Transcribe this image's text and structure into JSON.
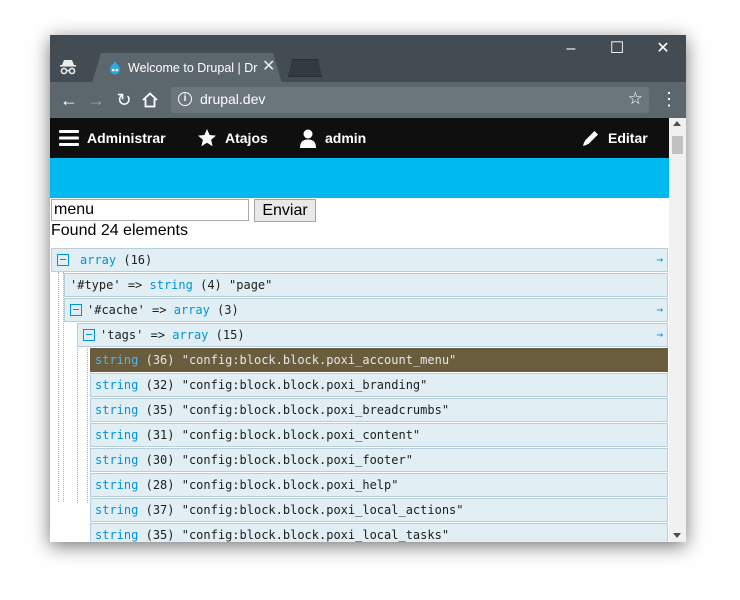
{
  "browser": {
    "tab_title": "Welcome to Drupal | Dru",
    "url": "drupal.dev",
    "window_controls": {
      "minimize": "–",
      "maximize": "☐",
      "close": "✕"
    },
    "tab_close": "✕"
  },
  "admin_toolbar": {
    "items": [
      {
        "label": "Administrar",
        "icon": "hamburger-icon"
      },
      {
        "label": "Atajos",
        "icon": "star-icon"
      },
      {
        "label": "admin",
        "icon": "user-icon"
      }
    ],
    "edit_label": "Editar",
    "edit_icon": "pencil-icon"
  },
  "search": {
    "value": "menu",
    "button_label": "Enviar",
    "result": "Found 24 elements"
  },
  "dump": {
    "root": {
      "type": "array",
      "meta": "(16)"
    },
    "type_entry": {
      "key": "'#type'",
      "op": "=>",
      "type": "string",
      "meta": "(4)",
      "value": "\"page\""
    },
    "cache_entry": {
      "key": "'#cache'",
      "op": "=>",
      "type": "array",
      "meta": "(3)"
    },
    "tags_entry": {
      "key": "'tags'",
      "op": "=>",
      "type": "array",
      "meta": "(15)"
    },
    "items": [
      {
        "type": "string",
        "meta": "(36)",
        "value": "\"config:block.block.poxi_account_menu\""
      },
      {
        "type": "string",
        "meta": "(32)",
        "value": "\"config:block.block.poxi_branding\""
      },
      {
        "type": "string",
        "meta": "(35)",
        "value": "\"config:block.block.poxi_breadcrumbs\""
      },
      {
        "type": "string",
        "meta": "(31)",
        "value": "\"config:block.block.poxi_content\""
      },
      {
        "type": "string",
        "meta": "(30)",
        "value": "\"config:block.block.poxi_footer\""
      },
      {
        "type": "string",
        "meta": "(28)",
        "value": "\"config:block.block.poxi_help\""
      },
      {
        "type": "string",
        "meta": "(37)",
        "value": "\"config:block.block.poxi_local_actions\""
      },
      {
        "type": "string",
        "meta": "(35)",
        "value": "\"config:block.block.poxi_local_tasks\""
      }
    ],
    "expand_arrow": "→"
  },
  "colors": {
    "admin_bar": "#0f0f0f",
    "brand_bar": "#00b9ee",
    "row_bg": "#e1eef4",
    "highlight_row": "#6a5d3e",
    "type_keyword": "#0092db"
  }
}
